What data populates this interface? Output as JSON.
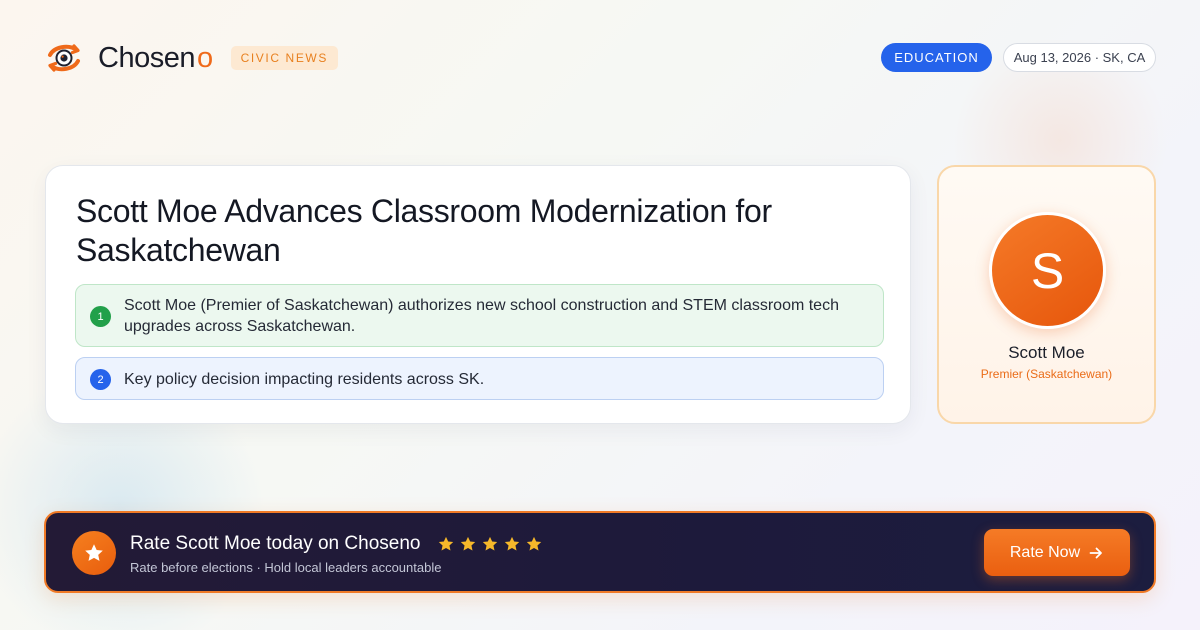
{
  "brand": {
    "name": "Chosen",
    "name_o": "o",
    "tag": "CIVIC NEWS",
    "logo_icon": "eye-icon",
    "accent": "#ef6a1a"
  },
  "header": {
    "category": "EDUCATION",
    "date_location": "Aug 13, 2026 · SK, CA"
  },
  "article": {
    "headline": "Scott Moe Advances Classroom Modernization  for Saskatchewan",
    "points": [
      {
        "number": "1",
        "text": "Scott Moe (Premier of Saskatchewan) authorizes new school construction and STEM classroom tech upgrades across Saskatchewan.",
        "color": "#22a04a"
      },
      {
        "number": "2",
        "text": "Key policy decision impacting residents across SK.",
        "color": "#2563eb"
      }
    ]
  },
  "profile": {
    "initial": "S",
    "name": "Scott Moe",
    "role": "Premier (Saskatchewan)"
  },
  "cta": {
    "title": "Rate Scott Moe today on Choseno",
    "rating_stars": 5,
    "subtitle": "Rate before elections · Hold local leaders accountable",
    "button_label": "Rate Now",
    "icon": "star-icon",
    "star_color": "#f6b82a"
  }
}
